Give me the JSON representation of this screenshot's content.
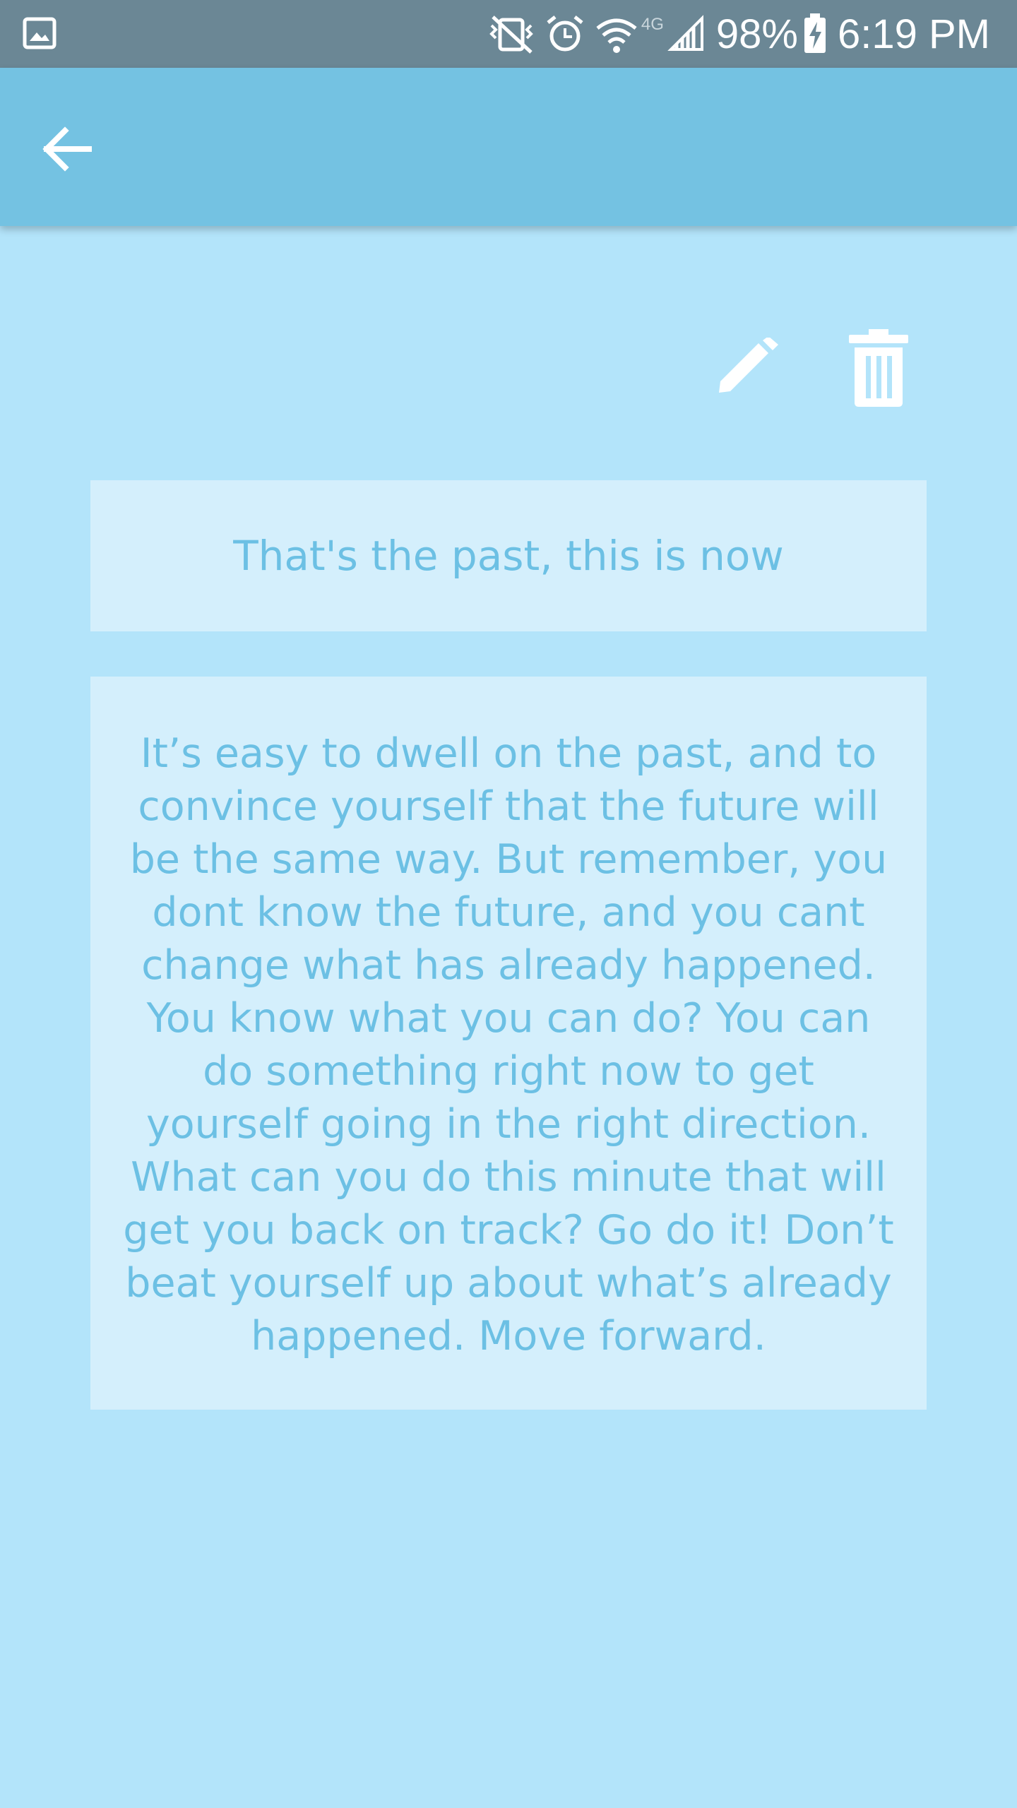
{
  "status_bar": {
    "battery": "98%",
    "time": "6:19 PM",
    "network": "4G",
    "icons": [
      "gallery-icon",
      "vibrate-mute-icon",
      "alarm-icon",
      "wifi-icon",
      "signal-icon",
      "battery-charging-icon"
    ]
  },
  "app_bar": {
    "back_icon": "arrow-back-icon"
  },
  "actions": {
    "edit_icon": "pencil-icon",
    "delete_icon": "trash-icon"
  },
  "note": {
    "title": "That's the past, this is now",
    "body": "It’s easy to dwell on the past, and to convince yourself that the future will be the same way. But remember, you dont know the future, and you cant change what has already happened. You know what you can do? You can do something right now to get yourself going in the right direction. What can you do this minute that will get you back on track? Go do it! Don’t beat yourself up about what’s already happened. Move forward."
  },
  "colors": {
    "background": "#b3e4fa",
    "app_bar": "#74c2e2",
    "status_bar": "#6b8795",
    "card": "#d4effc",
    "text": "#6cc0e4"
  }
}
